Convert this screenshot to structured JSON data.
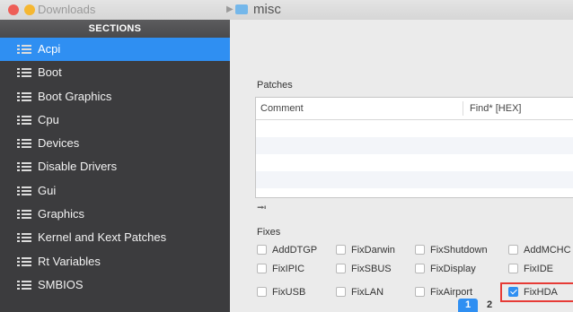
{
  "window": {
    "breadcrumb_1": "Downloads",
    "breadcrumb_2": "misc"
  },
  "sidebar": {
    "header": "SECTIONS",
    "items": [
      {
        "label": "Acpi",
        "active": true
      },
      {
        "label": "Boot"
      },
      {
        "label": "Boot Graphics"
      },
      {
        "label": "Cpu"
      },
      {
        "label": "Devices"
      },
      {
        "label": "Disable Drivers"
      },
      {
        "label": "Gui"
      },
      {
        "label": "Graphics"
      },
      {
        "label": "Kernel and Kext Patches"
      },
      {
        "label": "Rt Variables"
      },
      {
        "label": "SMBIOS"
      }
    ]
  },
  "patches": {
    "label": "Patches",
    "columns": [
      "Comment",
      "Find* [HEX]"
    ]
  },
  "fixes": {
    "label": "Fixes",
    "items": [
      {
        "label": "AddDTGP",
        "checked": false
      },
      {
        "label": "FixDarwin",
        "checked": false
      },
      {
        "label": "FixShutdown",
        "checked": false
      },
      {
        "label": "AddMCHC",
        "checked": false
      },
      {
        "label": "FixIPIC",
        "checked": false
      },
      {
        "label": "FixSBUS",
        "checked": false
      },
      {
        "label": "FixDisplay",
        "checked": false
      },
      {
        "label": "FixIDE",
        "checked": false
      },
      {
        "label": "FixUSB",
        "checked": false
      },
      {
        "label": "FixLAN",
        "checked": false
      },
      {
        "label": "FixAirport",
        "checked": false
      },
      {
        "label": "FixHDA",
        "checked": true
      }
    ]
  },
  "pagination": {
    "pages": [
      "1",
      "2"
    ],
    "current": "1"
  },
  "colors": {
    "accent": "#2f8ff2",
    "sidebar_bg": "#3c3c3e",
    "highlight": "#e63b36"
  }
}
